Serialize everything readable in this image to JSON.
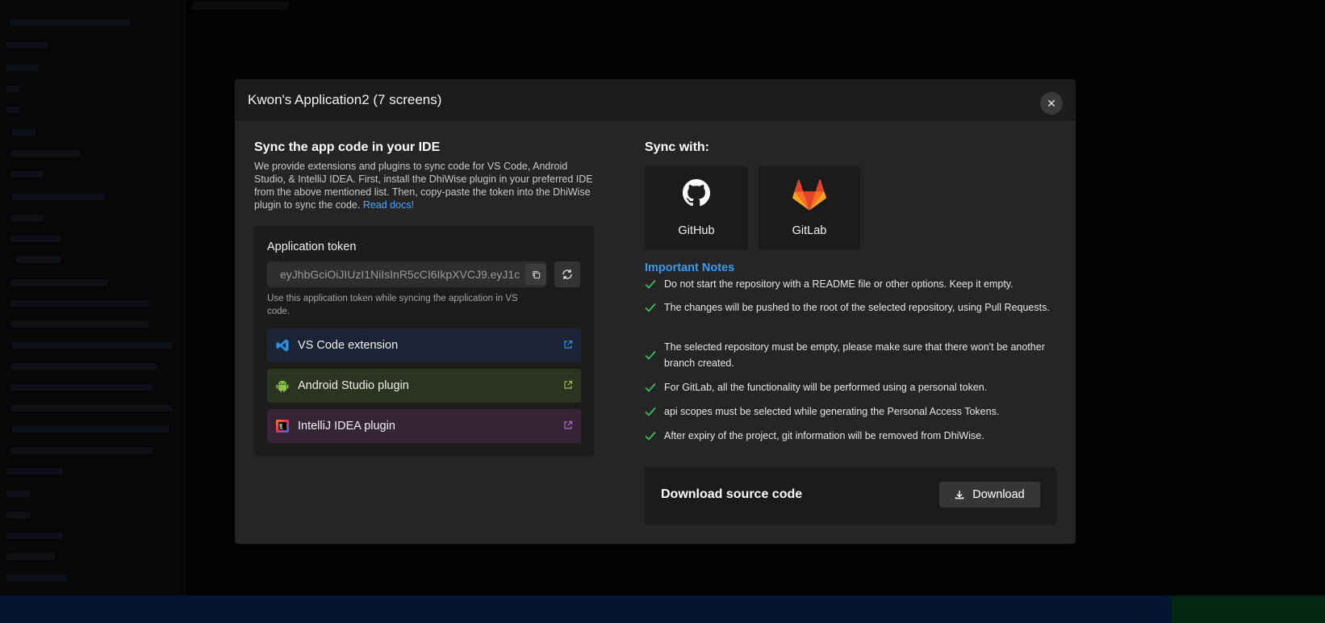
{
  "modal": {
    "title": "Kwon's Application2 (7 screens)",
    "close_icon": "close-icon"
  },
  "ide": {
    "heading": "Sync the app code in your IDE",
    "description": "We provide extensions and plugins to sync code for VS Code, Android Studio, & IntelliJ IDEA. First, install the DhiWise plugin in your preferred IDE from the above mentioned list. Then, copy-paste the token into the DhiWise plugin to sync the code.",
    "read_docs": "Read docs!",
    "token_label": "Application token",
    "token_value": "eyJhbGciOiJIUzI1NiIsInR5cCI6IkpXVCJ9.eyJ1c",
    "token_hint": "Use this application token while syncing the application in VS code.",
    "plugins": [
      {
        "label": "VS Code extension",
        "icon": "vscode-icon",
        "color": "#1a2434"
      },
      {
        "label": "Android Studio plugin",
        "icon": "android-icon",
        "color": "#2c3320"
      },
      {
        "label": "IntelliJ IDEA plugin",
        "icon": "intellij-icon",
        "color": "#352536"
      }
    ]
  },
  "sync": {
    "heading": "Sync with:",
    "providers": [
      {
        "label": "GitHub",
        "icon": "github-icon"
      },
      {
        "label": "GitLab",
        "icon": "gitlab-icon"
      }
    ]
  },
  "notes": {
    "heading": "Important Notes",
    "items": [
      "Do not start the repository with a README file or other options. Keep it empty.",
      "The changes will be pushed to the root of the selected repository, using Pull Requests.",
      "The selected repository must be empty, please make sure that there won't be another branch created.",
      "For GitLab, all the functionality will be performed using a personal token.",
      "api scopes must be selected while generating the Personal Access Tokens.",
      "After expiry of the project, git information will be removed from DhiWise."
    ]
  },
  "download": {
    "heading": "Download source code",
    "button": "Download"
  },
  "colors": {
    "accent_link": "#4ea5ff",
    "notes_blue": "#3a9bf0",
    "check_green": "#3fbf5a",
    "gitlab_orange": "#e24329"
  }
}
